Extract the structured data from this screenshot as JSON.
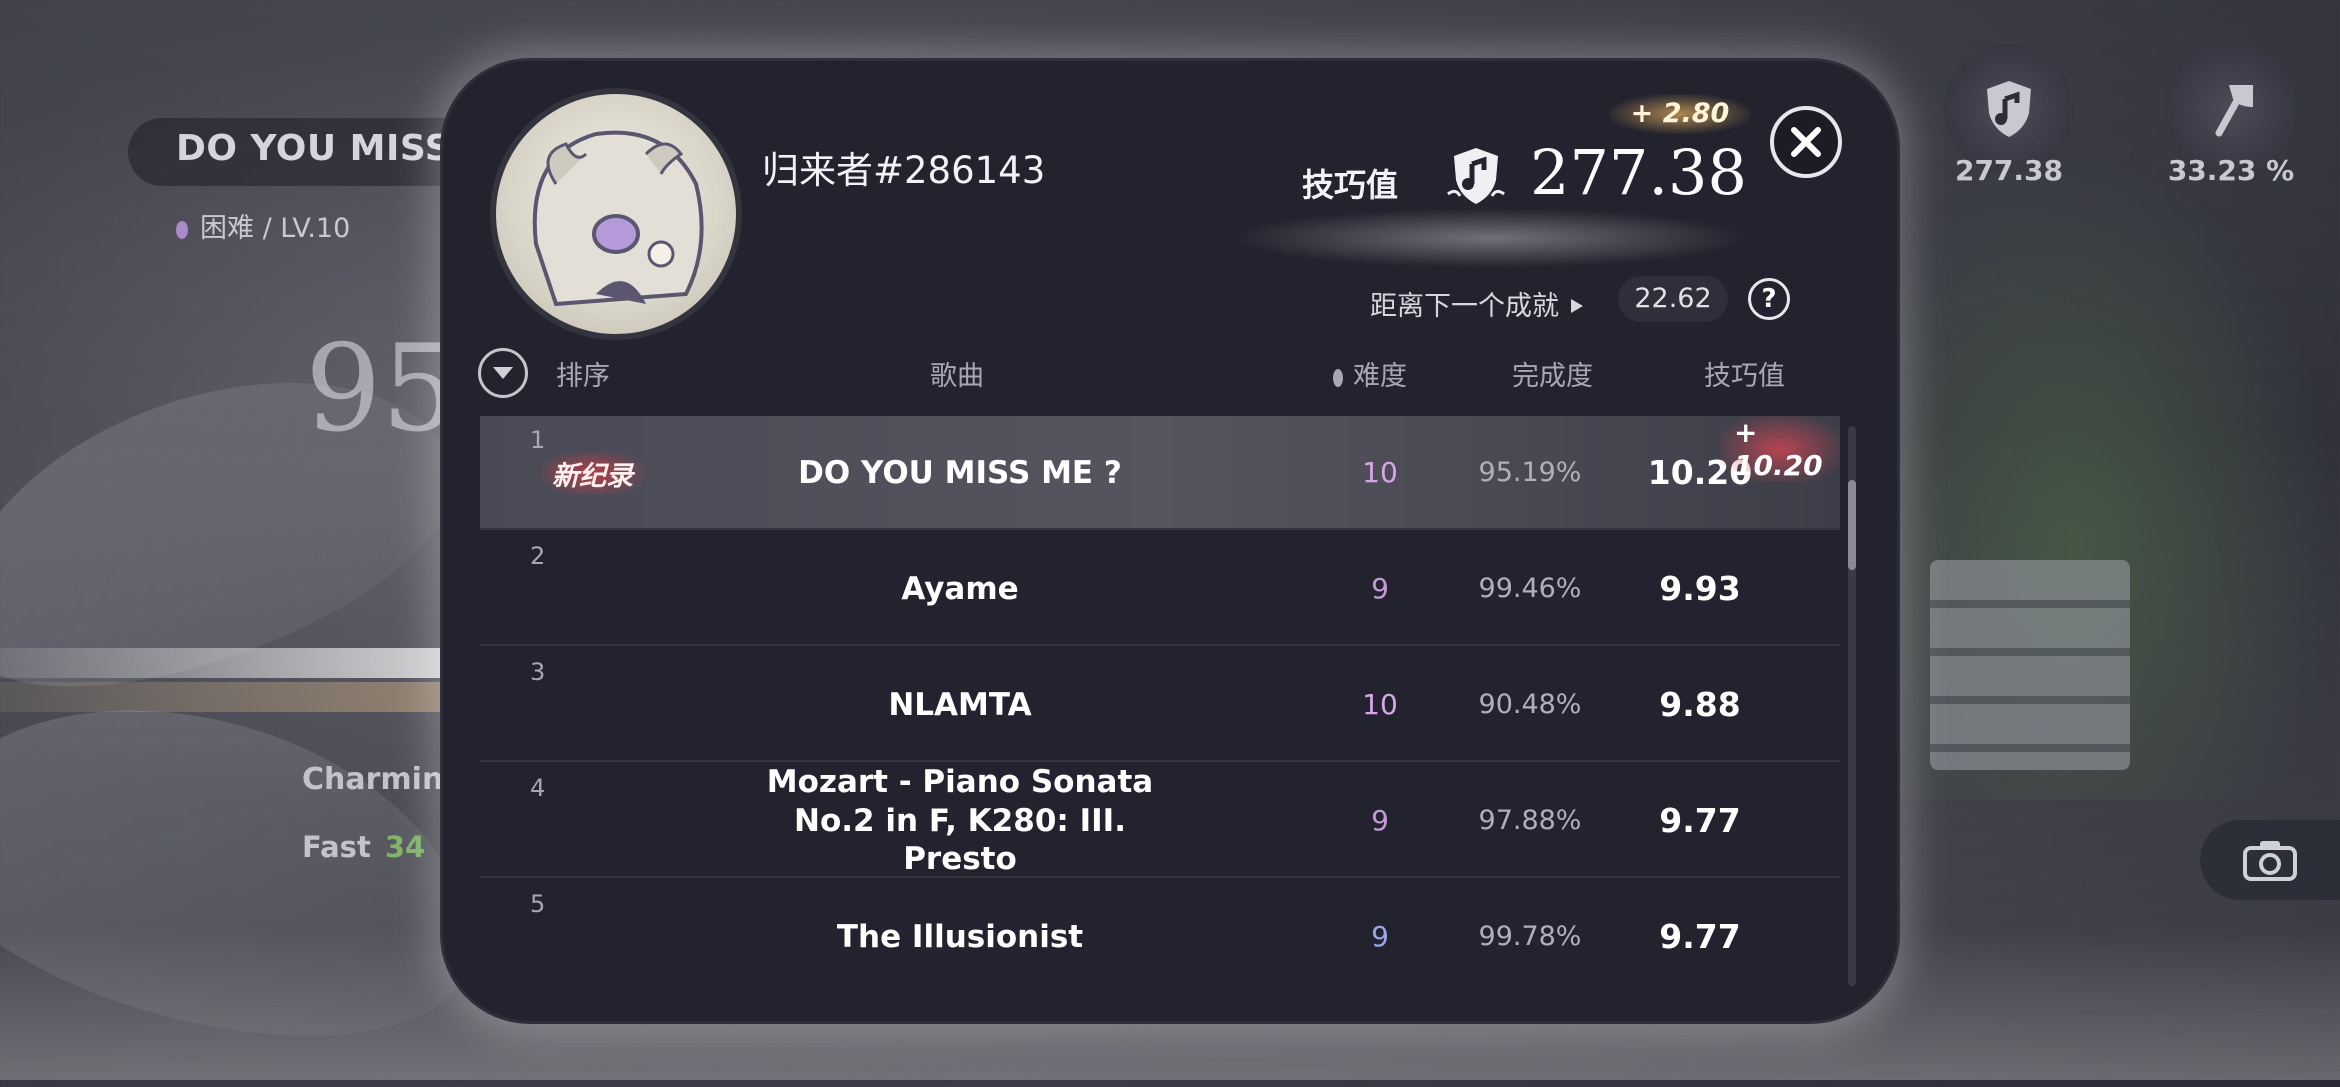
{
  "background": {
    "song_title": "DO YOU MISS ME ?",
    "difficulty_text": "困难 / LV.10",
    "score_partial": "95.",
    "judge_1": "Charming",
    "judge_2_label": "Fast",
    "judge_2_value": "34",
    "stat_skill": "277.38",
    "stat_percent": "33.23 %"
  },
  "player": {
    "name": "归来者#286143"
  },
  "skill": {
    "label": "技巧值",
    "value": "277.38",
    "delta": "+ 2.80",
    "next_label": "距离下一个成就",
    "next_value": "22.62"
  },
  "table": {
    "headers": {
      "rank": "排序",
      "song": "歌曲",
      "difficulty": "难度",
      "completion": "完成度",
      "skill": "技巧值"
    },
    "rows": [
      {
        "rank": "1",
        "song": "DO YOU MISS ME ?",
        "difficulty": "10",
        "completion": "95.19%",
        "skill": "10.20",
        "badge": "新纪录",
        "delta": "+ 10.20",
        "diff_color": "#d7a6e8"
      },
      {
        "rank": "2",
        "song": "Ayame",
        "difficulty": "9",
        "completion": "99.46%",
        "skill": "9.93",
        "diff_color": "#c69ad8"
      },
      {
        "rank": "3",
        "song": "NLAMTA",
        "difficulty": "10",
        "completion": "90.48%",
        "skill": "9.88",
        "diff_color": "#d7a6e8"
      },
      {
        "rank": "4",
        "song": "Mozart - Piano Sonata No.2 in F, K280: III. Presto",
        "difficulty": "9",
        "completion": "97.88%",
        "skill": "9.77",
        "diff_color": "#c69ad8"
      },
      {
        "rank": "5",
        "song": "The Illusionist",
        "difficulty": "9",
        "completion": "99.78%",
        "skill": "9.77",
        "diff_color": "#9aa6e8"
      }
    ]
  },
  "icons": {
    "close": "close-icon",
    "help": "help-icon",
    "sort": "sort-toggle-icon",
    "skill": "music-shield-icon",
    "camera": "camera-icon"
  }
}
